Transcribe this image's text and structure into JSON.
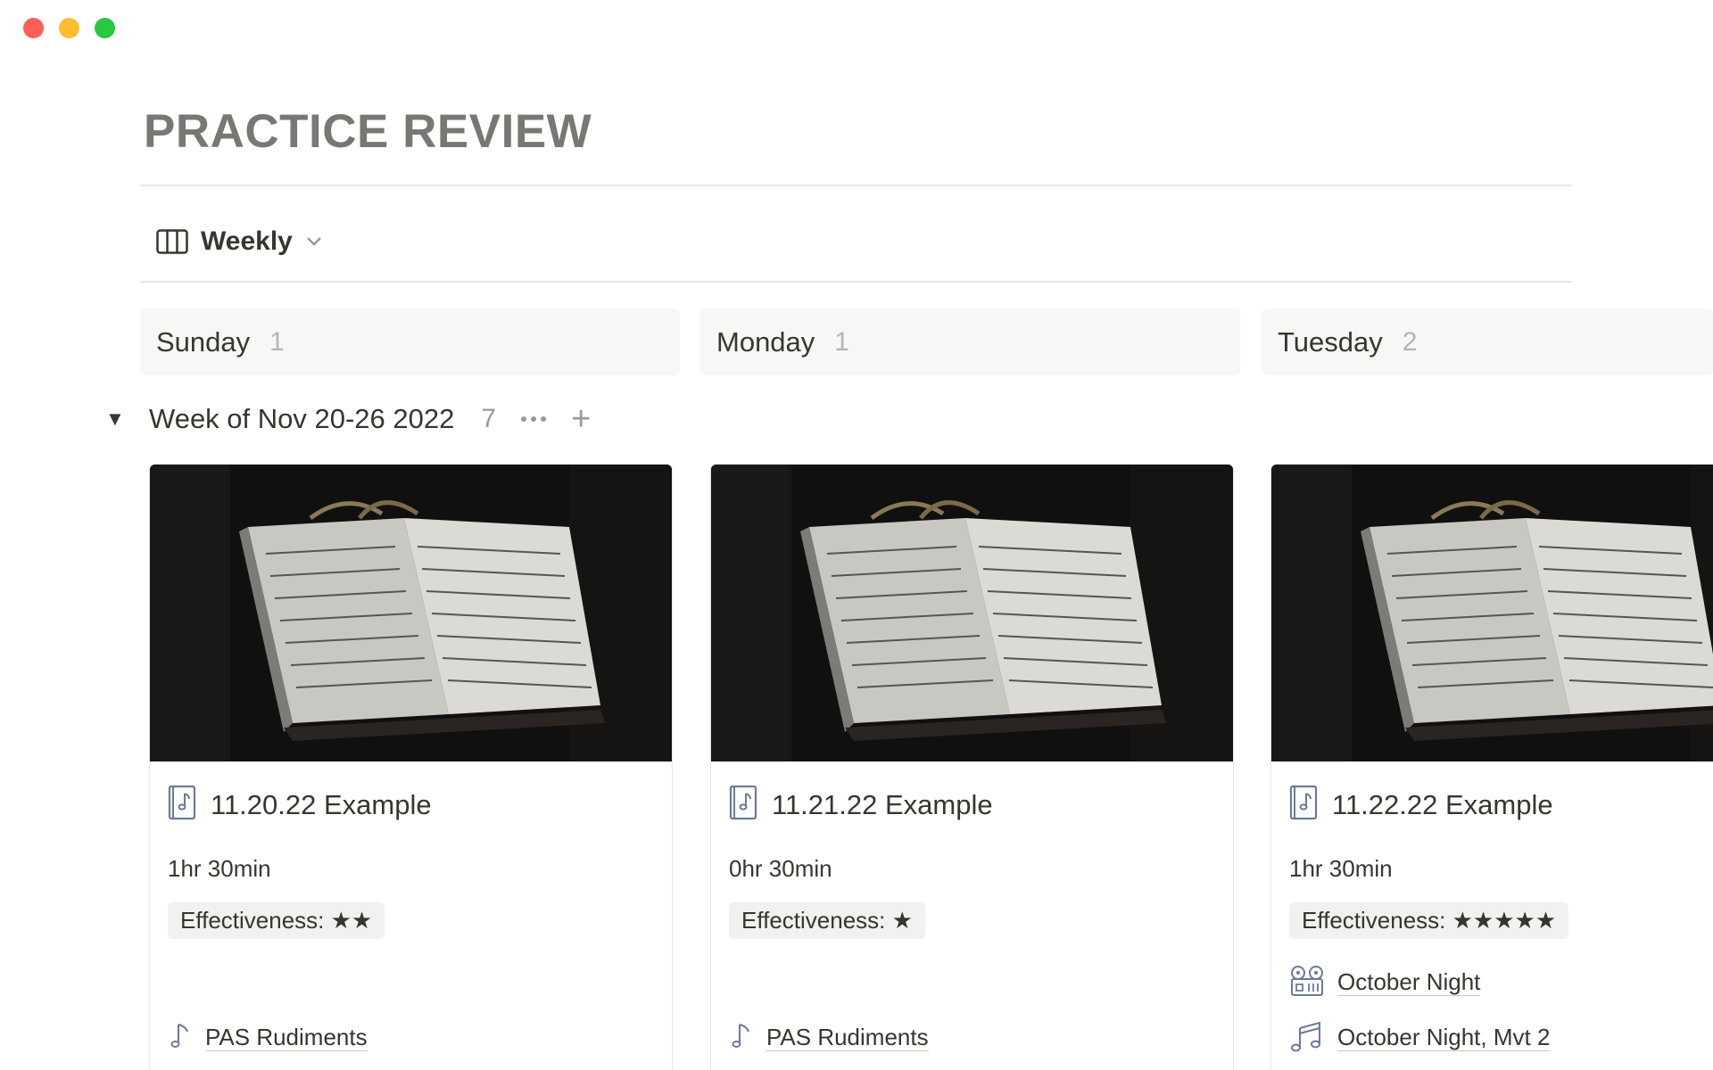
{
  "window": {
    "controls": [
      "close",
      "minimize",
      "zoom"
    ]
  },
  "page": {
    "title": "PRACTICE REVIEW"
  },
  "view": {
    "label": "Weekly",
    "icon": "board-icon"
  },
  "columns": [
    {
      "day": "Sunday",
      "count": "1"
    },
    {
      "day": "Monday",
      "count": "1"
    },
    {
      "day": "Tuesday",
      "count": "2"
    }
  ],
  "group": {
    "title": "Week of Nov 20-26 2022",
    "count": "7"
  },
  "cards": [
    {
      "title": "11.20.22 Example",
      "duration": "1hr 30min",
      "effectiveness": "Effectiveness: ★★",
      "links": [
        {
          "label": "PAS Rudiments",
          "icon": "music-note-icon"
        }
      ]
    },
    {
      "title": "11.21.22 Example",
      "duration": "0hr 30min",
      "effectiveness": "Effectiveness: ★",
      "links": [
        {
          "label": "PAS Rudiments",
          "icon": "music-note-icon"
        }
      ]
    },
    {
      "title": "11.22.22 Example",
      "duration": "1hr 30min",
      "effectiveness": "Effectiveness: ★★★★★",
      "links": [
        {
          "label": "October Night",
          "icon": "tape-recorder-icon"
        },
        {
          "label": "October Night, Mvt 2",
          "icon": "music-notes-icon"
        }
      ]
    }
  ],
  "colors": {
    "title": "#787774",
    "text": "#37352f",
    "muted": "#9b9a97",
    "column_bg": "#f7f7f5",
    "tag_bg": "#f1f1ef",
    "icon": "#6b7a99"
  }
}
